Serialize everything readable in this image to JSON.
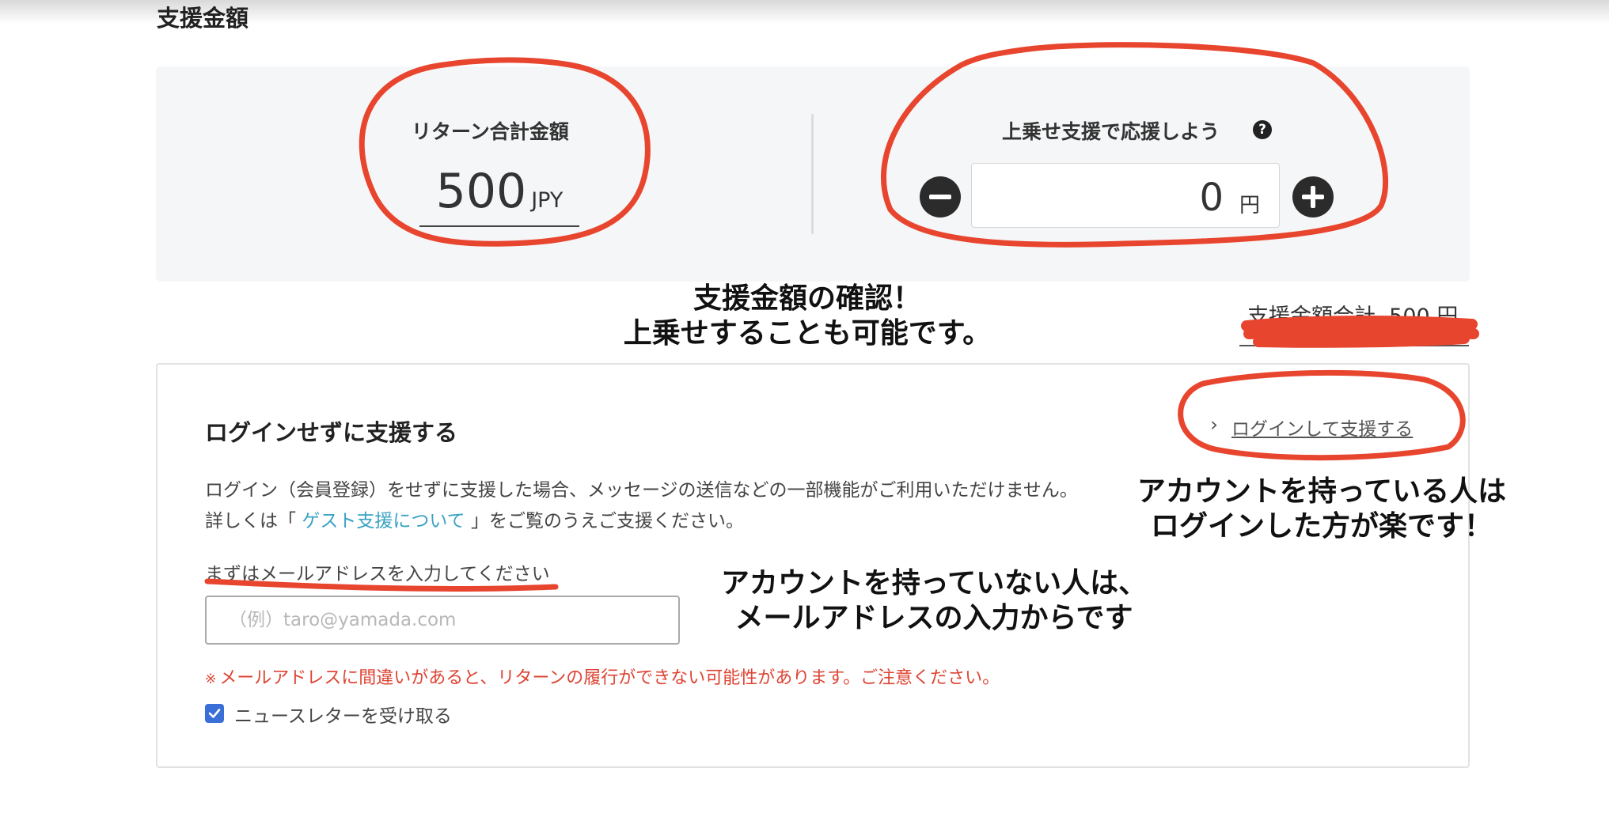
{
  "section_title": "支援金額",
  "return_total": {
    "label": "リターン合計金額",
    "amount": "500",
    "currency": "JPY"
  },
  "addon": {
    "label": "上乗せ支援で応援しよう",
    "help_icon": "?",
    "amount": "0",
    "unit": "円",
    "minus_icon": "minus-circle",
    "plus_icon": "plus-circle"
  },
  "total": {
    "label": "支援金額合計",
    "amount": "500",
    "unit": "円"
  },
  "guest": {
    "title": "ログインせずに支援する",
    "login_link": "ログインして支援する",
    "login_chevron": "›",
    "note_line1": "ログイン（会員登録）をせずに支援した場合、メッセージの送信などの一部機能がご利用いただけません。",
    "note_line2_prefix": "詳しくは「",
    "note_line2_link": "ゲスト支援について",
    "note_line2_suffix": "」をご覧のうえご支援ください。",
    "email_prompt": "まずはメールアドレスを入力してください",
    "email_placeholder": "（例）taro@yamada.com",
    "email_value": "",
    "warning_mark": "※",
    "warning": "メールアドレスに間違いがあると、リターンの履行ができない可能性があります。ご注意ください。",
    "newsletter_label": "ニュースレターを受け取る",
    "newsletter_checked": true
  },
  "annotations": {
    "confirm_line1": "支援金額の確認！",
    "confirm_line2": "上乗せすることも可能です。",
    "account_line1": "アカウントを持っている人は",
    "account_line2": "ログインした方が楽です！",
    "noaccount_line1": "アカウントを持っていない人は、",
    "noaccount_line2": "メールアドレスの入力からです",
    "marker_color": "#e8452f"
  },
  "colors": {
    "panel_bg": "#f5f6f7",
    "link": "#3aa3c4",
    "warning": "#dd4433",
    "checkbox": "#3a6fd8"
  }
}
